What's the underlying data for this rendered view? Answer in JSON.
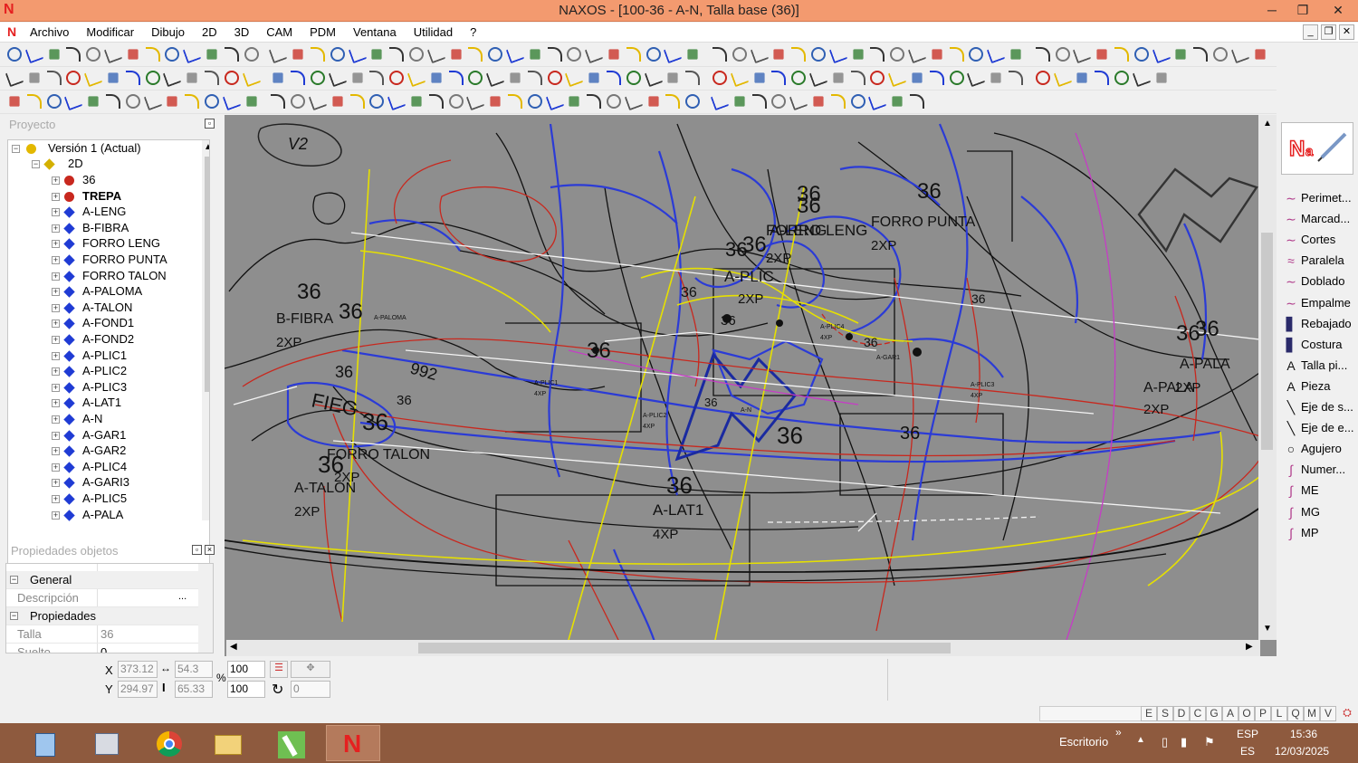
{
  "window": {
    "title": "NAXOS - [100-36 - A-N, Talla base (36)]",
    "logo_letter": "N",
    "buttons": [
      "─",
      "❐",
      "✕"
    ]
  },
  "menu": {
    "items": [
      "Archivo",
      "Modificar",
      "Dibujo",
      "2D",
      "3D",
      "CAM",
      "PDM",
      "Ventana",
      "Utilidad",
      "?"
    ],
    "mdi_buttons": [
      "_",
      "❐",
      "✕"
    ]
  },
  "project_panel": {
    "title": "Proyecto",
    "root": "Versión 1 (Actual)",
    "node2d": "2D",
    "items": [
      {
        "label": "36",
        "mark": "circle",
        "bold": false
      },
      {
        "label": "TREPA",
        "mark": "circle",
        "bold": true
      },
      {
        "label": "A-LENG",
        "mark": "diamond",
        "bold": false
      },
      {
        "label": "B-FIBRA",
        "mark": "diamond",
        "bold": false
      },
      {
        "label": "FORRO LENG",
        "mark": "diamond",
        "bold": false
      },
      {
        "label": "FORRO PUNTA",
        "mark": "diamond",
        "bold": false
      },
      {
        "label": "FORRO TALON",
        "mark": "diamond",
        "bold": false
      },
      {
        "label": "A-PALOMA",
        "mark": "diamond",
        "bold": false
      },
      {
        "label": "A-TALON",
        "mark": "diamond",
        "bold": false
      },
      {
        "label": "A-FOND1",
        "mark": "diamond",
        "bold": false
      },
      {
        "label": "A-FOND2",
        "mark": "diamond",
        "bold": false
      },
      {
        "label": "A-PLIC1",
        "mark": "diamond",
        "bold": false
      },
      {
        "label": "A-PLIC2",
        "mark": "diamond",
        "bold": false
      },
      {
        "label": "A-PLIC3",
        "mark": "diamond",
        "bold": false
      },
      {
        "label": "A-LAT1",
        "mark": "diamond",
        "bold": false
      },
      {
        "label": "A-N",
        "mark": "diamond",
        "bold": false
      },
      {
        "label": "A-GAR1",
        "mark": "diamond",
        "bold": false
      },
      {
        "label": "A-GAR2",
        "mark": "diamond",
        "bold": false
      },
      {
        "label": "A-PLIC4",
        "mark": "diamond",
        "bold": false
      },
      {
        "label": "A-GARI3",
        "mark": "diamond",
        "bold": false
      },
      {
        "label": "A-PLIC5",
        "mark": "diamond",
        "bold": false
      },
      {
        "label": "A-PALA",
        "mark": "diamond",
        "bold": false
      }
    ]
  },
  "props_panel": {
    "title": "Propiedades objetos",
    "general": "General",
    "descripcion": "Descripción",
    "propiedades": "Propiedades",
    "talla_key": "Talla",
    "talla_val": "36",
    "suelto_key": "Suelto",
    "suelto_val": "0"
  },
  "canvas_labels": {
    "sizes": [
      "36",
      "36",
      "36",
      "36",
      "36",
      "36",
      "36",
      "36",
      "36",
      "36",
      "36",
      "36",
      "36",
      "36",
      "36",
      "36",
      "36",
      "36",
      "36",
      "36",
      "36",
      "36"
    ],
    "pieces": [
      "B-FIBRA",
      "FORRO LENG",
      "A-LENG",
      "FORRO PUNTA",
      "A-PLIC",
      "FORRO TALON",
      "A-TALON",
      "A-LAT1",
      "A-PALA",
      "A-PALA",
      "FIEG",
      "992",
      "V2",
      "A-PALOMA",
      "A-PLIC1",
      "A-PLIC4",
      "A-PLIC2",
      "A-GAR1",
      "A-PLIC3",
      "A-N"
    ],
    "qty": [
      "2XP",
      "2XP",
      "2XP",
      "2XP",
      "2XP",
      "2XP",
      "4XP",
      "2XP",
      "2XP",
      "4XP",
      "4XP",
      "4XP",
      "4XP"
    ]
  },
  "right_panel": {
    "items": [
      {
        "label": "Perimet...",
        "icon": "curve-icon"
      },
      {
        "label": "Marcad...",
        "icon": "curve-icon"
      },
      {
        "label": "Cortes",
        "icon": "curve-icon"
      },
      {
        "label": "Paralela",
        "icon": "parallel-icon"
      },
      {
        "label": "Doblado",
        "icon": "fold-icon"
      },
      {
        "label": "Empalme",
        "icon": "join-icon"
      },
      {
        "label": "Rebajado",
        "icon": "skive-icon"
      },
      {
        "label": "Costura",
        "icon": "seam-icon"
      },
      {
        "label": "Talla pi...",
        "icon": "text-icon"
      },
      {
        "label": "Pieza",
        "icon": "text-icon"
      },
      {
        "label": "Eje de s...",
        "icon": "axis-icon"
      },
      {
        "label": "Eje de e...",
        "icon": "axis-icon"
      },
      {
        "label": "Agujero",
        "icon": "hole-icon"
      },
      {
        "label": "Numer...",
        "icon": "number-icon"
      },
      {
        "label": "ME",
        "icon": "mark-icon"
      },
      {
        "label": "MG",
        "icon": "mark-icon"
      },
      {
        "label": "MP",
        "icon": "mark-icon"
      }
    ]
  },
  "coords": {
    "x_label": "X",
    "y_label": "Y",
    "x": "373.12",
    "y": "294.97",
    "w": "54.3",
    "h": "65.33",
    "pct_sign": "%",
    "sx": "100",
    "sy": "100",
    "angle": "0"
  },
  "status_letters": [
    "E",
    "S",
    "D",
    "C",
    "G",
    "A",
    "O",
    "P",
    "L",
    "Q",
    "M",
    "V"
  ],
  "taskbar": {
    "desktop": "Escritorio",
    "chevron": "»",
    "lang1": "ESP",
    "lang2": "ES",
    "time": "15:36",
    "date": "12/03/2025"
  },
  "colors": {
    "titlebar": "#f39a6f",
    "canvas": "#8e8e8e",
    "taskbar": "#8e5a3e",
    "pattern_blue": "#2b3bd6",
    "pattern_red": "#c8281e",
    "pattern_yellow": "#e6e000"
  }
}
